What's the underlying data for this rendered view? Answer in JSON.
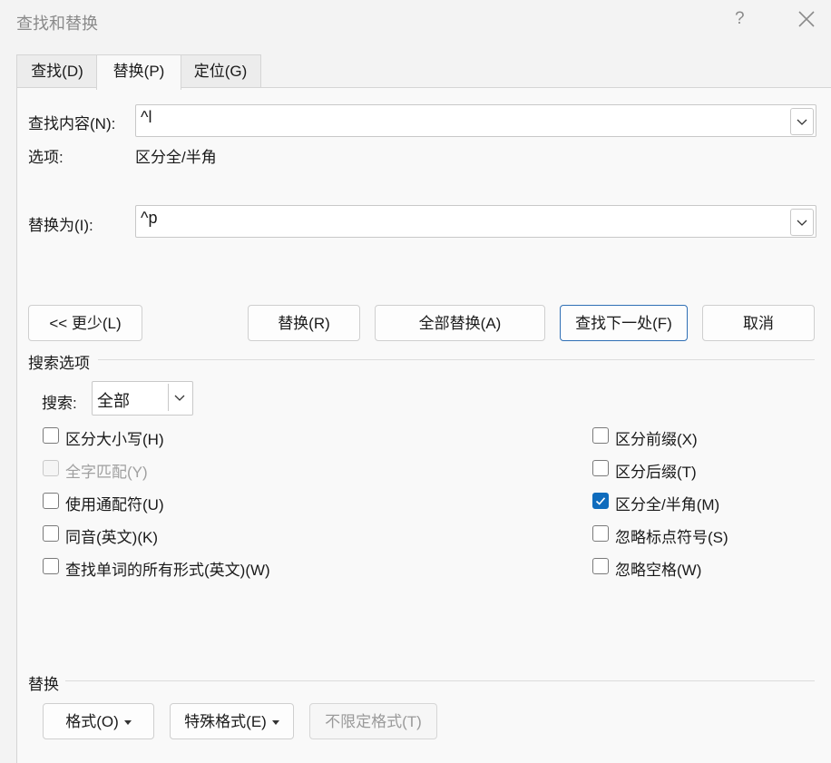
{
  "window": {
    "title": "查找和替换",
    "help": "?"
  },
  "tabs": [
    {
      "label": "查找(D)"
    },
    {
      "label": "替换(P)"
    },
    {
      "label": "定位(G)"
    }
  ],
  "find": {
    "label": "查找内容(N):",
    "value": "^l"
  },
  "options": {
    "label": "选项:",
    "value": "区分全/半角"
  },
  "replace": {
    "label": "替换为(I):",
    "value": "^p"
  },
  "buttons": {
    "less": "<< 更少(L)",
    "replace": "替换(R)",
    "replace_all": "全部替换(A)",
    "find_next": "查找下一处(F)",
    "cancel": "取消"
  },
  "search_options": {
    "header": "搜索选项",
    "search_label": "搜索:",
    "search_value": "全部"
  },
  "checkboxes_left": [
    {
      "label": "区分大小写(H)",
      "checked": false,
      "disabled": false
    },
    {
      "label": "全字匹配(Y)",
      "checked": false,
      "disabled": true
    },
    {
      "label": "使用通配符(U)",
      "checked": false,
      "disabled": false
    },
    {
      "label": "同音(英文)(K)",
      "checked": false,
      "disabled": false
    },
    {
      "label": "查找单词的所有形式(英文)(W)",
      "checked": false,
      "disabled": false
    }
  ],
  "checkboxes_right": [
    {
      "label": "区分前缀(X)",
      "checked": false,
      "disabled": false
    },
    {
      "label": "区分后缀(T)",
      "checked": false,
      "disabled": false
    },
    {
      "label": "区分全/半角(M)",
      "checked": true,
      "disabled": false
    },
    {
      "label": "忽略标点符号(S)",
      "checked": false,
      "disabled": false
    },
    {
      "label": "忽略空格(W)",
      "checked": false,
      "disabled": false
    }
  ],
  "replace_section": {
    "header": "替换",
    "format": "格式(O)",
    "special": "特殊格式(E)",
    "no_format": "不限定格式(T)"
  },
  "colors": {
    "accent": "#0f6cbd"
  }
}
